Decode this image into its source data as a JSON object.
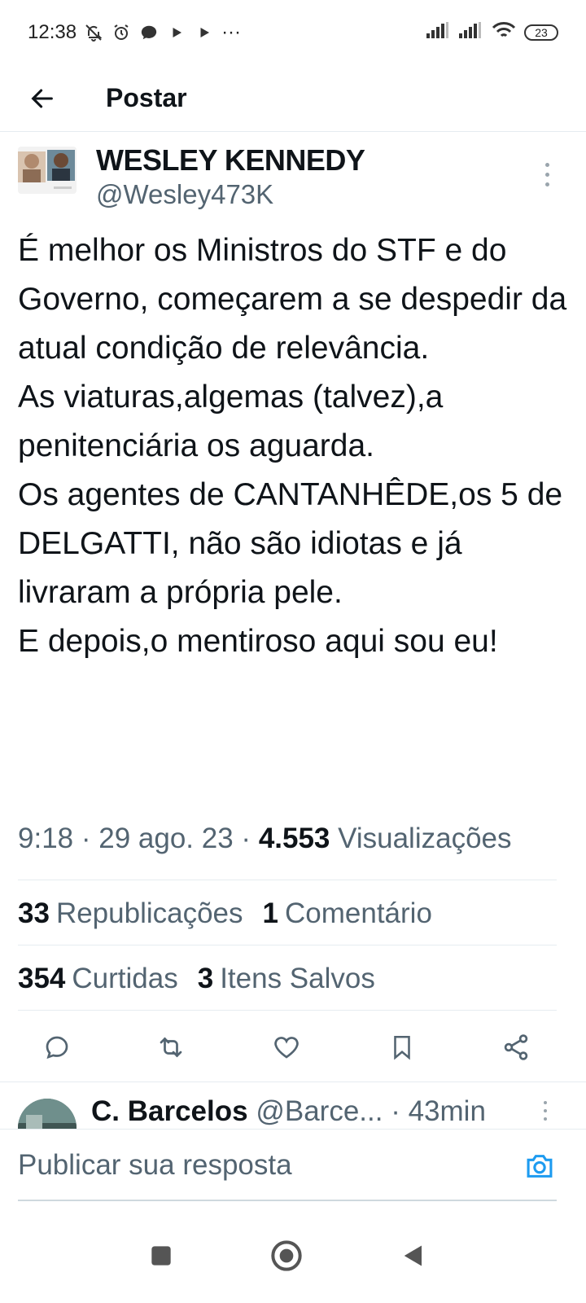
{
  "status_bar": {
    "time": "12:38",
    "more": "···",
    "battery": "23"
  },
  "topbar": {
    "title": "Postar"
  },
  "post": {
    "author_name": "WESLEY KENNEDY",
    "author_handle": "@Wesley473K",
    "text_lines": [
      "É melhor os Ministros do STF e do Governo, começarem a se despedir da atual condição de relevância.",
      "As viaturas,algemas (talvez),a penitenciária os aguarda.",
      "Os agentes de CANTANHÊDE,os 5 de DELGATTI, não são idiotas e já livraram a própria pele.",
      "E depois,o mentiroso aqui sou eu!"
    ],
    "time": "9:18",
    "date": "29 ago. 23",
    "views_count": "4.553",
    "views_label": "Visualizações"
  },
  "stats": {
    "reposts_count": "33",
    "reposts_label": "Republicações",
    "comments_count": "1",
    "comments_label": "Comentário",
    "likes_count": "354",
    "likes_label": "Curtidas",
    "saves_count": "3",
    "saves_label": "Itens Salvos"
  },
  "reply": {
    "name": "C. Barcelos",
    "handle": "@Barce...",
    "time": "43min"
  },
  "compose": {
    "placeholder": "Publicar sua resposta"
  },
  "colors": {
    "accent": "#1d9bf0",
    "text": "#0f1419",
    "secondary": "#536471",
    "divider": "#e6ecf0"
  },
  "icons": {
    "back": "arrow-left-icon",
    "more": "more-vertical-icon",
    "reply": "reply-icon",
    "repost": "repost-icon",
    "like": "heart-icon",
    "bookmark": "bookmark-icon",
    "share": "share-icon",
    "camera": "camera-icon"
  }
}
